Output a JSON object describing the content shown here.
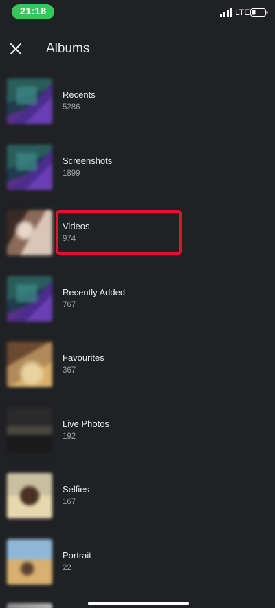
{
  "status_bar": {
    "time": "21:18",
    "network": "LTE",
    "signal_icon": "cellular-signal-icon",
    "battery_icon": "battery-icon"
  },
  "header": {
    "close_icon": "close-icon",
    "title": "Albums"
  },
  "albums": [
    {
      "name": "Recents",
      "count": "5286"
    },
    {
      "name": "Screenshots",
      "count": "1899"
    },
    {
      "name": "Videos",
      "count": "974"
    },
    {
      "name": "Recently Added",
      "count": "767"
    },
    {
      "name": "Favourites",
      "count": "367"
    },
    {
      "name": "Live Photos",
      "count": "192"
    },
    {
      "name": "Selfies",
      "count": "167"
    },
    {
      "name": "Portrait",
      "count": "22"
    }
  ],
  "colors": {
    "background": "#202124",
    "time_pill": "#34c759",
    "highlight": "#e8102e",
    "secondary_text": "#9aa0a6"
  }
}
